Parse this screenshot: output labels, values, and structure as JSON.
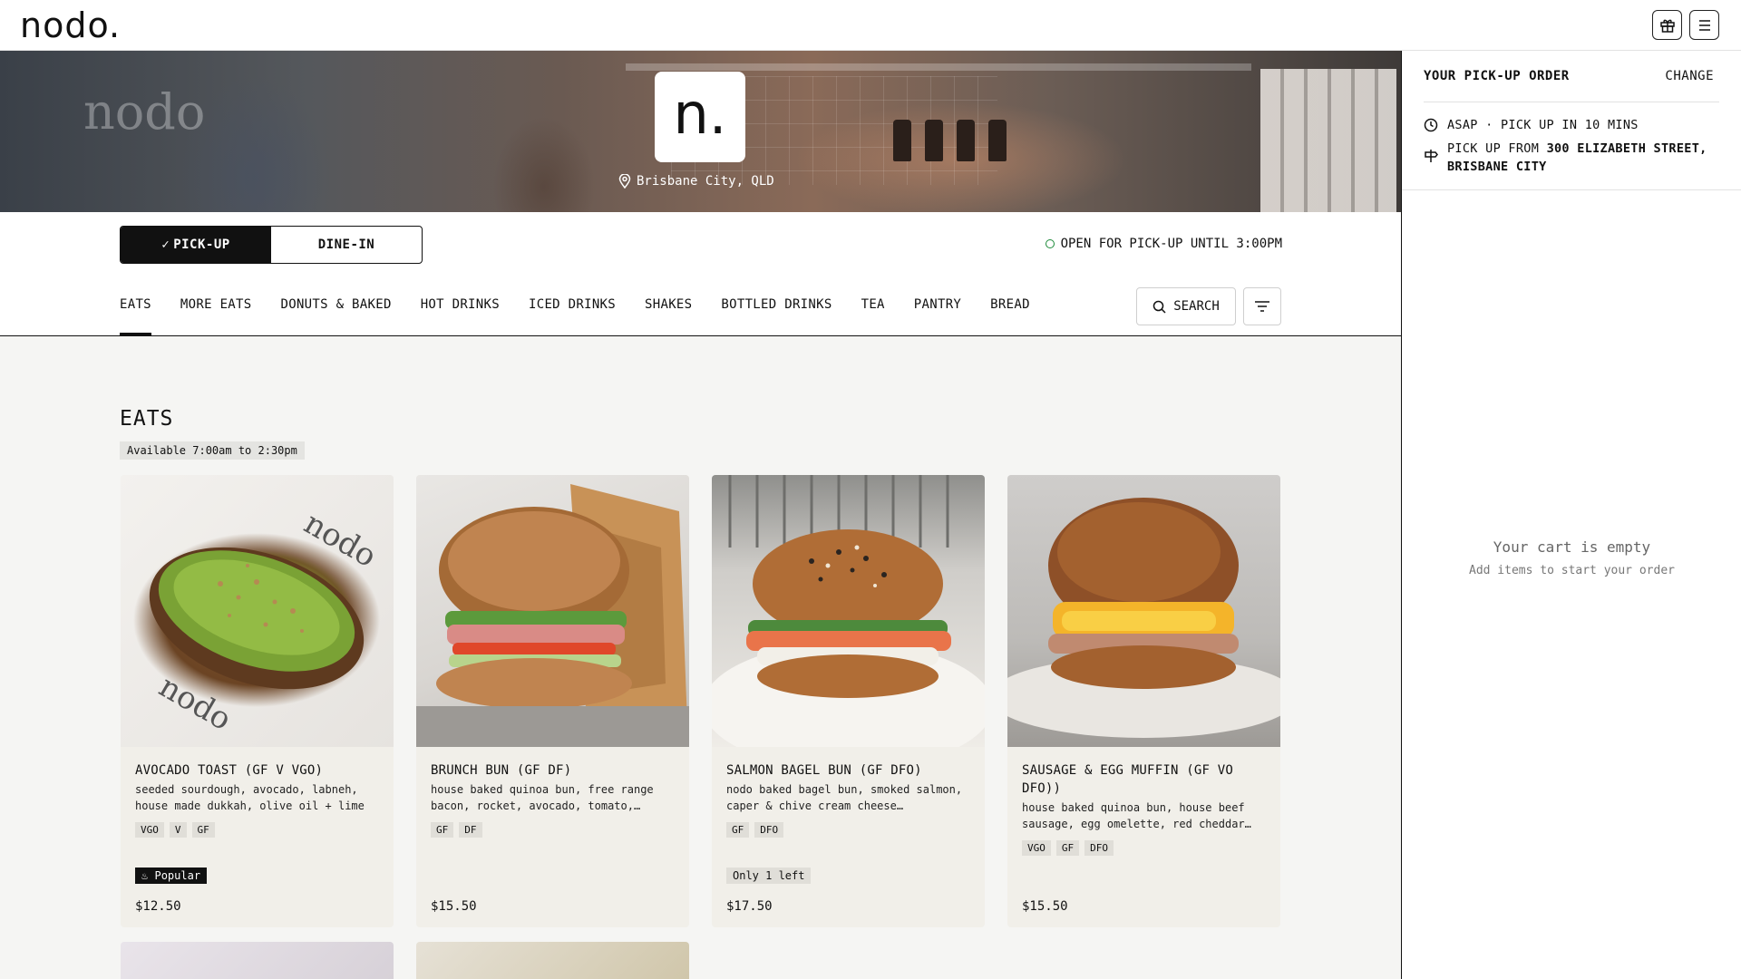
{
  "brand": {
    "logo_text": "nodo."
  },
  "header": {
    "icons": [
      "gift-icon",
      "menu-icon"
    ]
  },
  "hero": {
    "badge_letter": "n.",
    "location": "Brisbane City, QLD",
    "background_word": "nodo"
  },
  "order_mode": {
    "options": [
      {
        "label": "PICK-UP",
        "active": true
      },
      {
        "label": "DINE-IN",
        "active": false
      }
    ],
    "status": "OPEN FOR PICK-UP UNTIL 3:00PM",
    "status_color": "#1d8a3a"
  },
  "categories": [
    {
      "label": "EATS",
      "active": true
    },
    {
      "label": "MORE EATS",
      "active": false
    },
    {
      "label": "DONUTS & BAKED",
      "active": false
    },
    {
      "label": "HOT DRINKS",
      "active": false
    },
    {
      "label": "ICED DRINKS",
      "active": false
    },
    {
      "label": "SHAKES",
      "active": false
    },
    {
      "label": "BOTTLED DRINKS",
      "active": false
    },
    {
      "label": "TEA",
      "active": false
    },
    {
      "label": "PANTRY",
      "active": false
    },
    {
      "label": "BREAD",
      "active": false
    }
  ],
  "search": {
    "label": "SEARCH"
  },
  "section": {
    "title": "EATS",
    "availability": "Available 7:00am to 2:30pm"
  },
  "products": [
    {
      "name": "AVOCADO TOAST (GF V VGO)",
      "desc": "seeded sourdough, avocado, labneh, house made dukkah, olive oil + lime",
      "tags": [
        "VGO",
        "V",
        "GF"
      ],
      "badge": "Popular",
      "badge_style": "dark",
      "price": "$12.50"
    },
    {
      "name": "BRUNCH BUN (GF DF)",
      "desc": "house baked quinoa bun, free range bacon, rocket, avocado, tomato,…",
      "tags": [
        "GF",
        "DF"
      ],
      "badge": "",
      "badge_style": "",
      "price": "$15.50"
    },
    {
      "name": "SALMON BAGEL BUN (GF DFO)",
      "desc": "nodo baked bagel bun, smoked salmon, caper & chive cream cheese…",
      "tags": [
        "GF",
        "DFO"
      ],
      "badge": "Only 1 left",
      "badge_style": "light",
      "price": "$17.50"
    },
    {
      "name": "SAUSAGE & EGG MUFFIN (GF VO DFO))",
      "desc": "house baked quinoa bun, house beef sausage, egg omelette, red cheddar…",
      "tags": [
        "VGO",
        "GF",
        "DFO"
      ],
      "badge": "",
      "badge_style": "",
      "price": "$15.50"
    }
  ],
  "cart": {
    "title": "YOUR PICK-UP ORDER",
    "change_label": "CHANGE",
    "time_label": "ASAP · PICK UP IN 10 MINS",
    "pickup_prefix": "PICK UP FROM ",
    "pickup_address": "300 ELIZABETH STREET, BRISBANE CITY",
    "empty_title": "Your cart is empty",
    "empty_subtitle": "Add items to start your order"
  }
}
